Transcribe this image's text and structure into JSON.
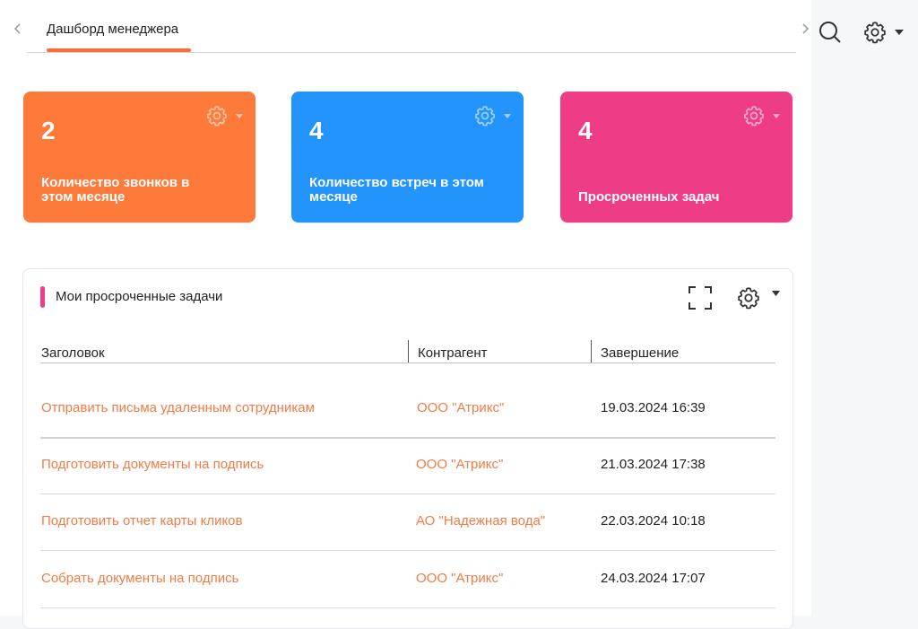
{
  "tabs": {
    "active_label": "Дашборд менеджера"
  },
  "kpi_cards": [
    {
      "value": "2",
      "label": "Количество звонков в этом месяце",
      "color": "#fe7a3a"
    },
    {
      "value": "4",
      "label": "Количество встреч в этом месяце",
      "color": "#2394fc"
    },
    {
      "value": "4",
      "label": "Просроченных задач",
      "color": "#ee3d86"
    }
  ],
  "overdue_panel": {
    "title": "Мои просроченные задачи",
    "accent_color": "#ee3d86",
    "columns": [
      "Заголовок",
      "Контрагент",
      "Завершение"
    ],
    "rows": [
      {
        "title": "Отправить письма удаленным сотрудникам",
        "counterparty": "ООО \"Атрикс\"",
        "due": "19.03.2024 16:39"
      },
      {
        "title": "Подготовить документы на подпись",
        "counterparty": "ООО \"Атрикс\"",
        "due": "21.03.2024 17:38"
      },
      {
        "title": "Подготовить отчет карты кликов",
        "counterparty": "АО \"Надежная вода\"",
        "due": "22.03.2024 10:18"
      },
      {
        "title": "Собрать документы на подпись",
        "counterparty": "ООО \"Атрикс\"",
        "due": "24.03.2024 17:07"
      }
    ]
  },
  "icons": {
    "tab_prev": "chevron-left-icon",
    "tab_next": "chevron-right-icon",
    "search": "search-icon",
    "settings": "gear-icon",
    "expand": "expand-icon"
  },
  "colors": {
    "link": "#f27c45",
    "tab_underline": "#ff6b35"
  }
}
